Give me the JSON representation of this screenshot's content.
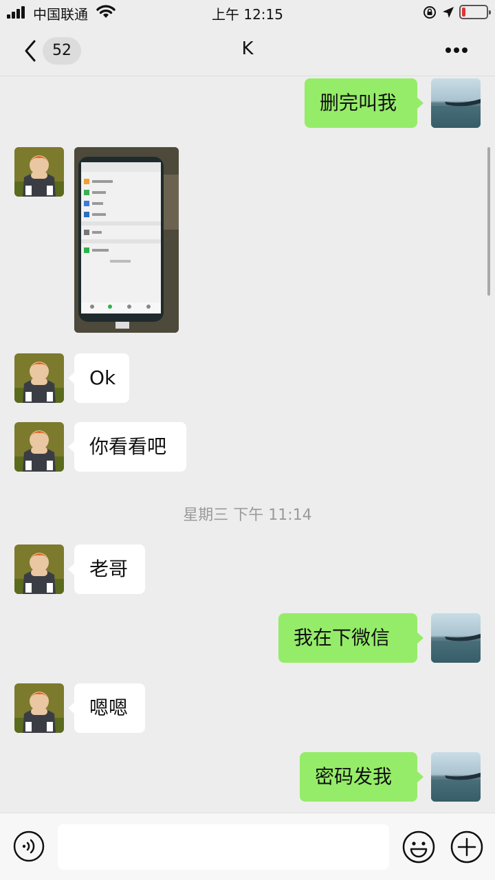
{
  "status_bar": {
    "carrier": "中国联通",
    "time": "上午 12:15",
    "battery_level": 0.15,
    "battery_color": "#e33333"
  },
  "nav": {
    "unread_count": "52",
    "title": "K",
    "back_icon": "chevron-left-icon",
    "more_icon": "more-dots-icon"
  },
  "messages": [
    {
      "side": "out",
      "text": "删完叫我"
    },
    {
      "side": "in",
      "type": "image",
      "description_icon": "phone-photo"
    },
    {
      "side": "in",
      "text": "Ok"
    },
    {
      "side": "in",
      "text": "你看看吧"
    },
    {
      "side": "in",
      "text": "老哥"
    },
    {
      "side": "out",
      "text": "我在下微信"
    },
    {
      "side": "in",
      "text": "嗯嗯"
    },
    {
      "side": "out",
      "text": "密码发我"
    }
  ],
  "timestamp": "星期三 下午 11:14",
  "input_bar": {
    "voice_icon": "voice-icon",
    "emoji_icon": "emoji-icon",
    "plus_icon": "plus-icon",
    "value": ""
  },
  "colors": {
    "outgoing_bubble": "#95ec69",
    "incoming_bubble": "#ffffff",
    "background": "#ededed"
  }
}
